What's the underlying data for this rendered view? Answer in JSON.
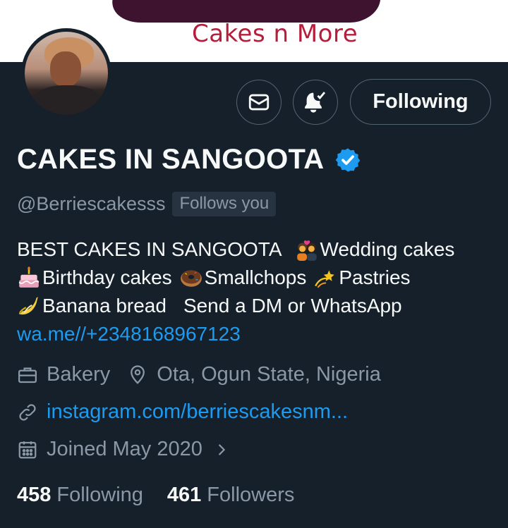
{
  "banner": {
    "subtitle": "Cakes n More"
  },
  "actions": {
    "follow_label": "Following"
  },
  "profile": {
    "name": "CAKES IN SANGOOTA",
    "handle": "@Berriescakesss",
    "follows_you": "Follows you"
  },
  "bio": {
    "line1_text": "BEST CAKES IN SANGOOTA",
    "line1_item": "Wedding cakes",
    "line2_item1": "Birthday cakes",
    "line2_item2": "Smallchops",
    "line2_item3": "Pastries",
    "line3_item1": "Banana bread",
    "line3_text": "Send a DM or WhatsApp",
    "link": "wa.me//+2348168967123",
    "emojis": [
      "couple-with-heart-icon",
      "birthday-cake-icon",
      "doughnut-icon",
      "dizzy-icon",
      "banana-icon"
    ]
  },
  "meta": {
    "category": "Bakery",
    "location": "Ota, Ogun State, Nigeria",
    "website": "instagram.com/berriescakesnm...",
    "joined": "Joined May 2020"
  },
  "stats": {
    "following_count": "458",
    "following_label": "Following",
    "followers_count": "461",
    "followers_label": "Followers"
  },
  "colors": {
    "background": "#15202b",
    "accent": "#1d9bf0",
    "secondary_text": "#8b98a5",
    "banner_brand": "#b51e3b"
  }
}
